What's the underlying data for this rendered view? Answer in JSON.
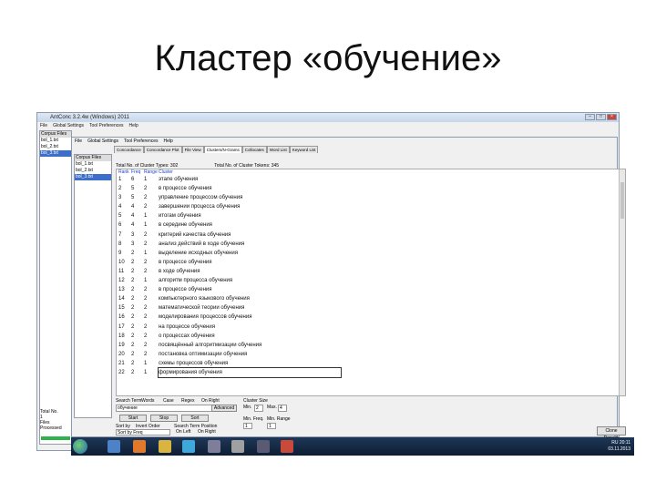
{
  "slide": {
    "title": "Кластер «обучение»"
  },
  "outer_window": {
    "title": "AntConc 3.2.4w (Windows) 2011",
    "menu": [
      "File",
      "Global Settings",
      "Tool Preferences",
      "Help"
    ],
    "corpus_files_header": "Corpus Files",
    "files": [
      "bol_1.txt",
      "bol_2.txt",
      "bol_3.txt"
    ],
    "total_no_label": "Total No.",
    "total_no_value": "1",
    "files_processed_label": "Files Processed"
  },
  "inner_window": {
    "menu": [
      "File",
      "Global Settings",
      "Tool Preferences",
      "Help"
    ],
    "corpus_header": "Corpus Files",
    "files": [
      "bol_1.txt",
      "bol_2.txt",
      "bol_3.txt"
    ],
    "tabs": [
      "Concordance",
      "Concordance Plot",
      "File View",
      "Clusters/N-Grams",
      "Collocates",
      "Word List",
      "Keyword List"
    ],
    "active_tab": "Clusters/N-Grams",
    "total_cluster_types": "Total No. of Cluster Types: 302",
    "total_cluster_tokens": "Total No. of Cluster Tokens: 345",
    "columns": [
      "Rank",
      "Freq",
      "Range",
      "Cluster"
    ],
    "rows": [
      [
        "1",
        "6",
        "1",
        "этапе обучения"
      ],
      [
        "2",
        "5",
        "2",
        "в процессе обучения"
      ],
      [
        "3",
        "5",
        "2",
        "управление процессом обучения"
      ],
      [
        "4",
        "4",
        "2",
        "завершении процесса обучения"
      ],
      [
        "5",
        "4",
        "1",
        "итогам обучения"
      ],
      [
        "6",
        "4",
        "1",
        "в середине обучения"
      ],
      [
        "7",
        "3",
        "2",
        "критерий качества обучения"
      ],
      [
        "8",
        "3",
        "2",
        "анализ действий в ходе обучения"
      ],
      [
        "9",
        "2",
        "1",
        "выделение исходных обучения"
      ],
      [
        "10",
        "2",
        "2",
        "в процессе обучения"
      ],
      [
        "11",
        "2",
        "2",
        "в ходе обучения"
      ],
      [
        "12",
        "2",
        "1",
        "алгоритм процесса обучения"
      ],
      [
        "13",
        "2",
        "2",
        "в процессе обучения"
      ],
      [
        "14",
        "2",
        "2",
        "компьютерного языкового обучения"
      ],
      [
        "15",
        "2",
        "2",
        "математической теории обучения"
      ],
      [
        "16",
        "2",
        "2",
        "моделирования процессов обучения"
      ],
      [
        "17",
        "2",
        "2",
        "на процессе обучения"
      ],
      [
        "18",
        "2",
        "2",
        "о процессах обучения"
      ],
      [
        "19",
        "2",
        "2",
        "посвящённый алгоритмизации обучения"
      ],
      [
        "20",
        "2",
        "2",
        "постановка оптимизации обучения"
      ],
      [
        "21",
        "2",
        "1",
        "схемы процессов обучения"
      ],
      [
        "22",
        "2",
        "1",
        "формирования обучения"
      ]
    ],
    "search_term_label": "Search Term",
    "search_term_value": "обучение",
    "options": [
      "Words",
      "Case",
      "Regex",
      "On Right"
    ],
    "advanced_label": "Advanced",
    "cluster_size_label": "Cluster Size",
    "min_label": "Min.",
    "max_label": "Max.",
    "min_value": "2",
    "max_value": "4",
    "start_label": "Start",
    "stop_label": "Stop",
    "sort_label": "Sort",
    "sort_by_label": "Sort by",
    "invert_order_label": "Invert Order",
    "sort_by_value": "Sort by Freq",
    "search_term_position_label": "Search Term Position",
    "on_left_label": "On Left",
    "on_right_label": "On Right",
    "min_freq_label": "Min. Freq.",
    "min_range_label": "Min. Range",
    "min_freq_value": "1",
    "min_range_value": "1",
    "clone_results": "Clone Results"
  },
  "taskbar": {
    "tray_lang": "RU",
    "time": "20:11",
    "date": "03.11.2013"
  }
}
